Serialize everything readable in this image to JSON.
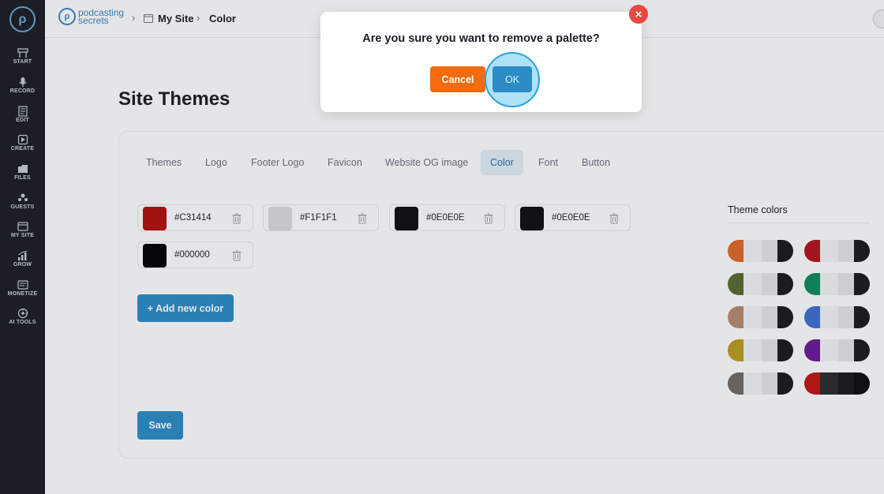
{
  "sidebar": {
    "items": [
      {
        "label": "START",
        "icon": "start-icon"
      },
      {
        "label": "RECORD",
        "icon": "microphone-icon"
      },
      {
        "label": "EDIT",
        "icon": "edit-icon"
      },
      {
        "label": "CREATE",
        "icon": "create-icon"
      },
      {
        "label": "FILES",
        "icon": "files-icon"
      },
      {
        "label": "GUESTS",
        "icon": "guests-icon"
      },
      {
        "label": "MY SITE",
        "icon": "my-site-icon"
      },
      {
        "label": "GROW",
        "icon": "grow-icon"
      },
      {
        "label": "MONETIZE",
        "icon": "monetize-icon"
      },
      {
        "label": "AI TOOLS",
        "icon": "ai-tools-icon"
      }
    ]
  },
  "header": {
    "brand_line1": "podcasting",
    "brand_line2": "secrets",
    "breadcrumb": [
      "My Site",
      "Color"
    ]
  },
  "page": {
    "title": "Site Themes",
    "tabs": [
      "Themes",
      "Logo",
      "Footer Logo",
      "Favicon",
      "Website OG image",
      "Color",
      "Font",
      "Button"
    ],
    "active_tab": "Color",
    "colors": [
      {
        "hex": "#C31414",
        "swatch": "#b30f0f"
      },
      {
        "hex": "#F1F1F1",
        "swatch": "#dcdcdc"
      },
      {
        "hex": "#0E0E0E",
        "swatch": "#0e0e0e"
      },
      {
        "hex": "#0E0E0E",
        "swatch": "#0e0e0e"
      },
      {
        "hex": "#000000",
        "swatch": "#000000"
      }
    ],
    "add_color_label": "+ Add new color",
    "save_label": "Save",
    "theme_colors_title": "Theme colors",
    "theme_palettes": [
      [
        "#e0692a",
        "#f4f4f4",
        "#e6e6e6",
        "#1b1b1b"
      ],
      [
        "#b3151b",
        "#f4f4f4",
        "#e6e6e6",
        "#1b1b1b"
      ],
      [
        "#5b6b2f",
        "#f4f4f4",
        "#e6e6e6",
        "#1b1b1b"
      ],
      [
        "#0f8a5f",
        "#f4f4f4",
        "#e6e6e6",
        "#1b1b1b"
      ],
      [
        "#b88a72",
        "#f4f4f4",
        "#e6e6e6",
        "#1b1b1b"
      ],
      [
        "#3f6fd0",
        "#f4f4f4",
        "#e6e6e6",
        "#1b1b1b"
      ],
      [
        "#bf9c1f",
        "#f4f4f4",
        "#e6e6e6",
        "#1b1b1b"
      ],
      [
        "#6a1a9a",
        "#f4f4f4",
        "#e6e6e6",
        "#1b1b1b"
      ],
      [
        "#6f6a66",
        "#f4f4f4",
        "#e6e6e6",
        "#1b1b1b"
      ],
      [
        "#c31414",
        "#2b2b2b",
        "#1a1a1a",
        "#0e0e0e"
      ]
    ]
  },
  "modal": {
    "message": "Are you sure you want to remove a palette?",
    "cancel_label": "Cancel",
    "ok_label": "OK",
    "close_label": "×"
  },
  "colors": {
    "accent": "#2b8cc6",
    "cancel": "#f56b0f",
    "close": "#e9473f",
    "sidebar_bg": "#1b1e24"
  }
}
